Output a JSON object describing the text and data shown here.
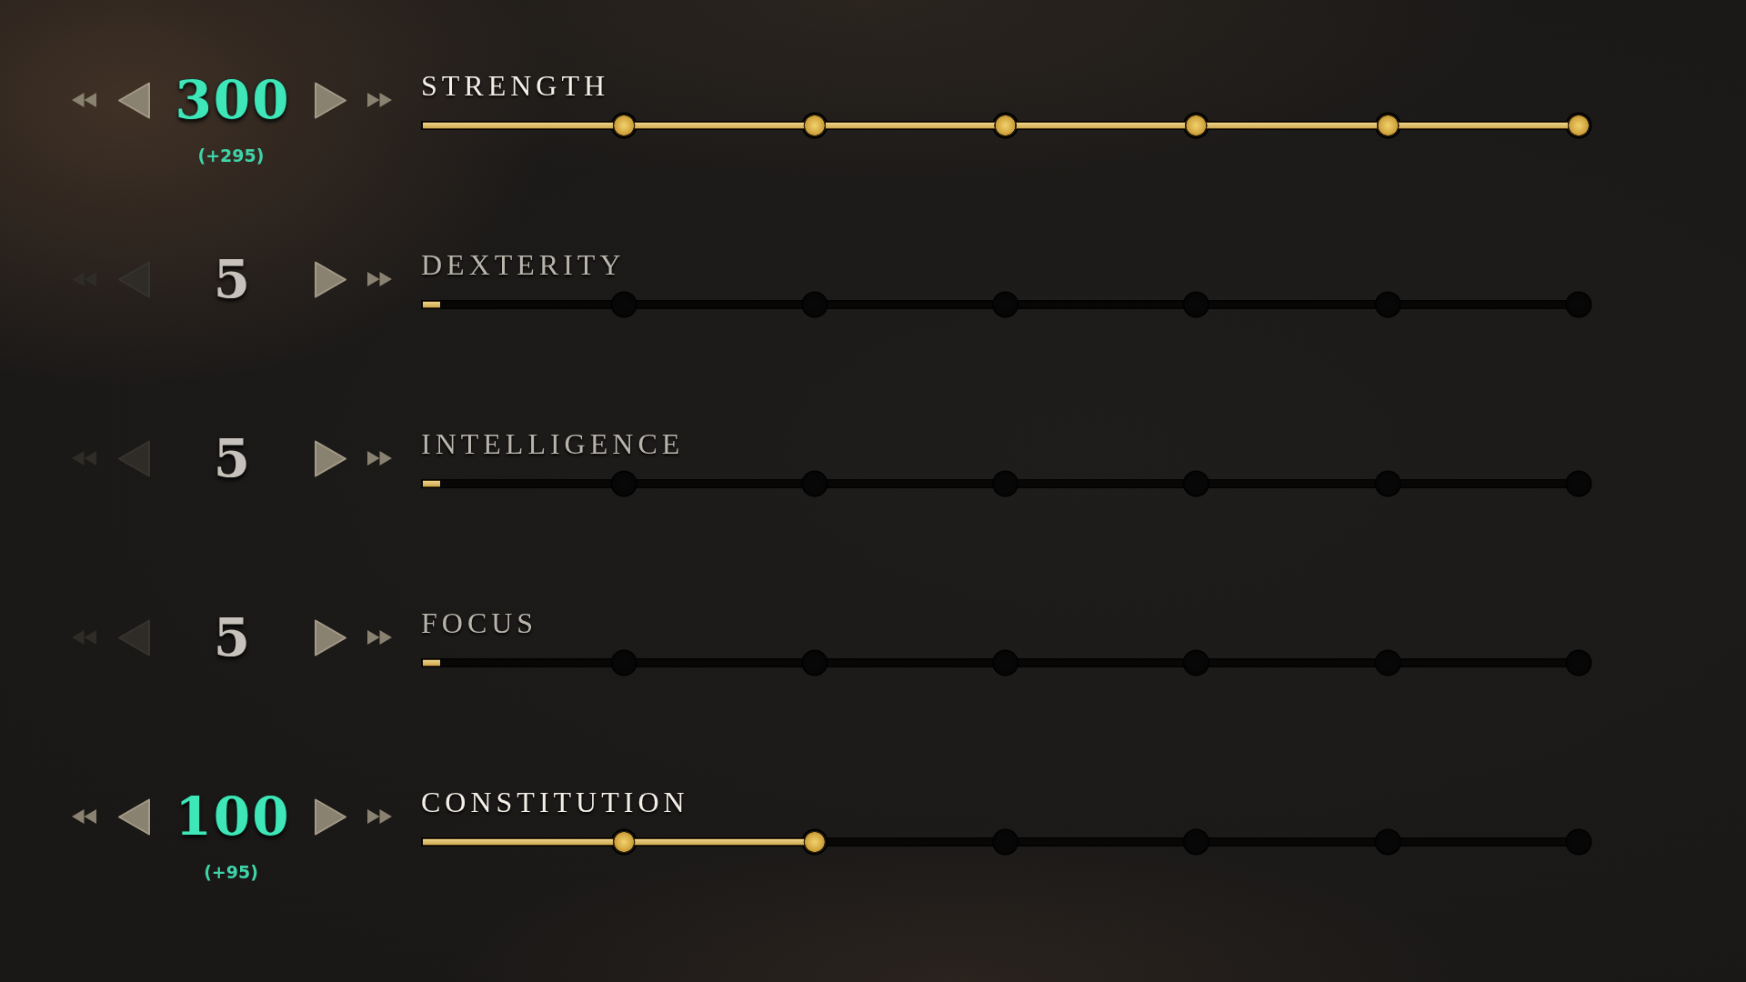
{
  "attributes": [
    {
      "name": "STRENGTH",
      "value": "300",
      "delta": "(+295)",
      "modified": true,
      "level": 1,
      "controls": [
        {
          "kind": "min",
          "disabled": false
        },
        {
          "kind": "dec",
          "disabled": false
        },
        {
          "kind": "inc",
          "disabled": false
        },
        {
          "kind": "max",
          "disabled": false
        }
      ]
    },
    {
      "name": "DEXTERITY",
      "value": "5",
      "modified": false,
      "level": 0.015,
      "controls": [
        {
          "kind": "min",
          "disabled": true
        },
        {
          "kind": "dec",
          "disabled": true
        },
        {
          "kind": "inc",
          "disabled": false
        },
        {
          "kind": "max",
          "disabled": false
        }
      ]
    },
    {
      "name": "INTELLIGENCE",
      "value": "5",
      "modified": false,
      "level": 0.015,
      "controls": [
        {
          "kind": "min",
          "disabled": true
        },
        {
          "kind": "dec",
          "disabled": true
        },
        {
          "kind": "inc",
          "disabled": false
        },
        {
          "kind": "max",
          "disabled": false
        }
      ]
    },
    {
      "name": "FOCUS",
      "value": "5",
      "modified": false,
      "level": 0.015,
      "controls": [
        {
          "kind": "min",
          "disabled": true
        },
        {
          "kind": "dec",
          "disabled": true
        },
        {
          "kind": "inc",
          "disabled": false
        },
        {
          "kind": "max",
          "disabled": false
        }
      ]
    },
    {
      "name": "CONSTITUTION",
      "value": "100",
      "delta": "(+95)",
      "modified": true,
      "level": 0.34,
      "controls": [
        {
          "kind": "min",
          "disabled": false
        },
        {
          "kind": "dec",
          "disabled": false
        },
        {
          "kind": "inc",
          "disabled": false
        },
        {
          "kind": "max",
          "disabled": false
        }
      ]
    }
  ]
}
